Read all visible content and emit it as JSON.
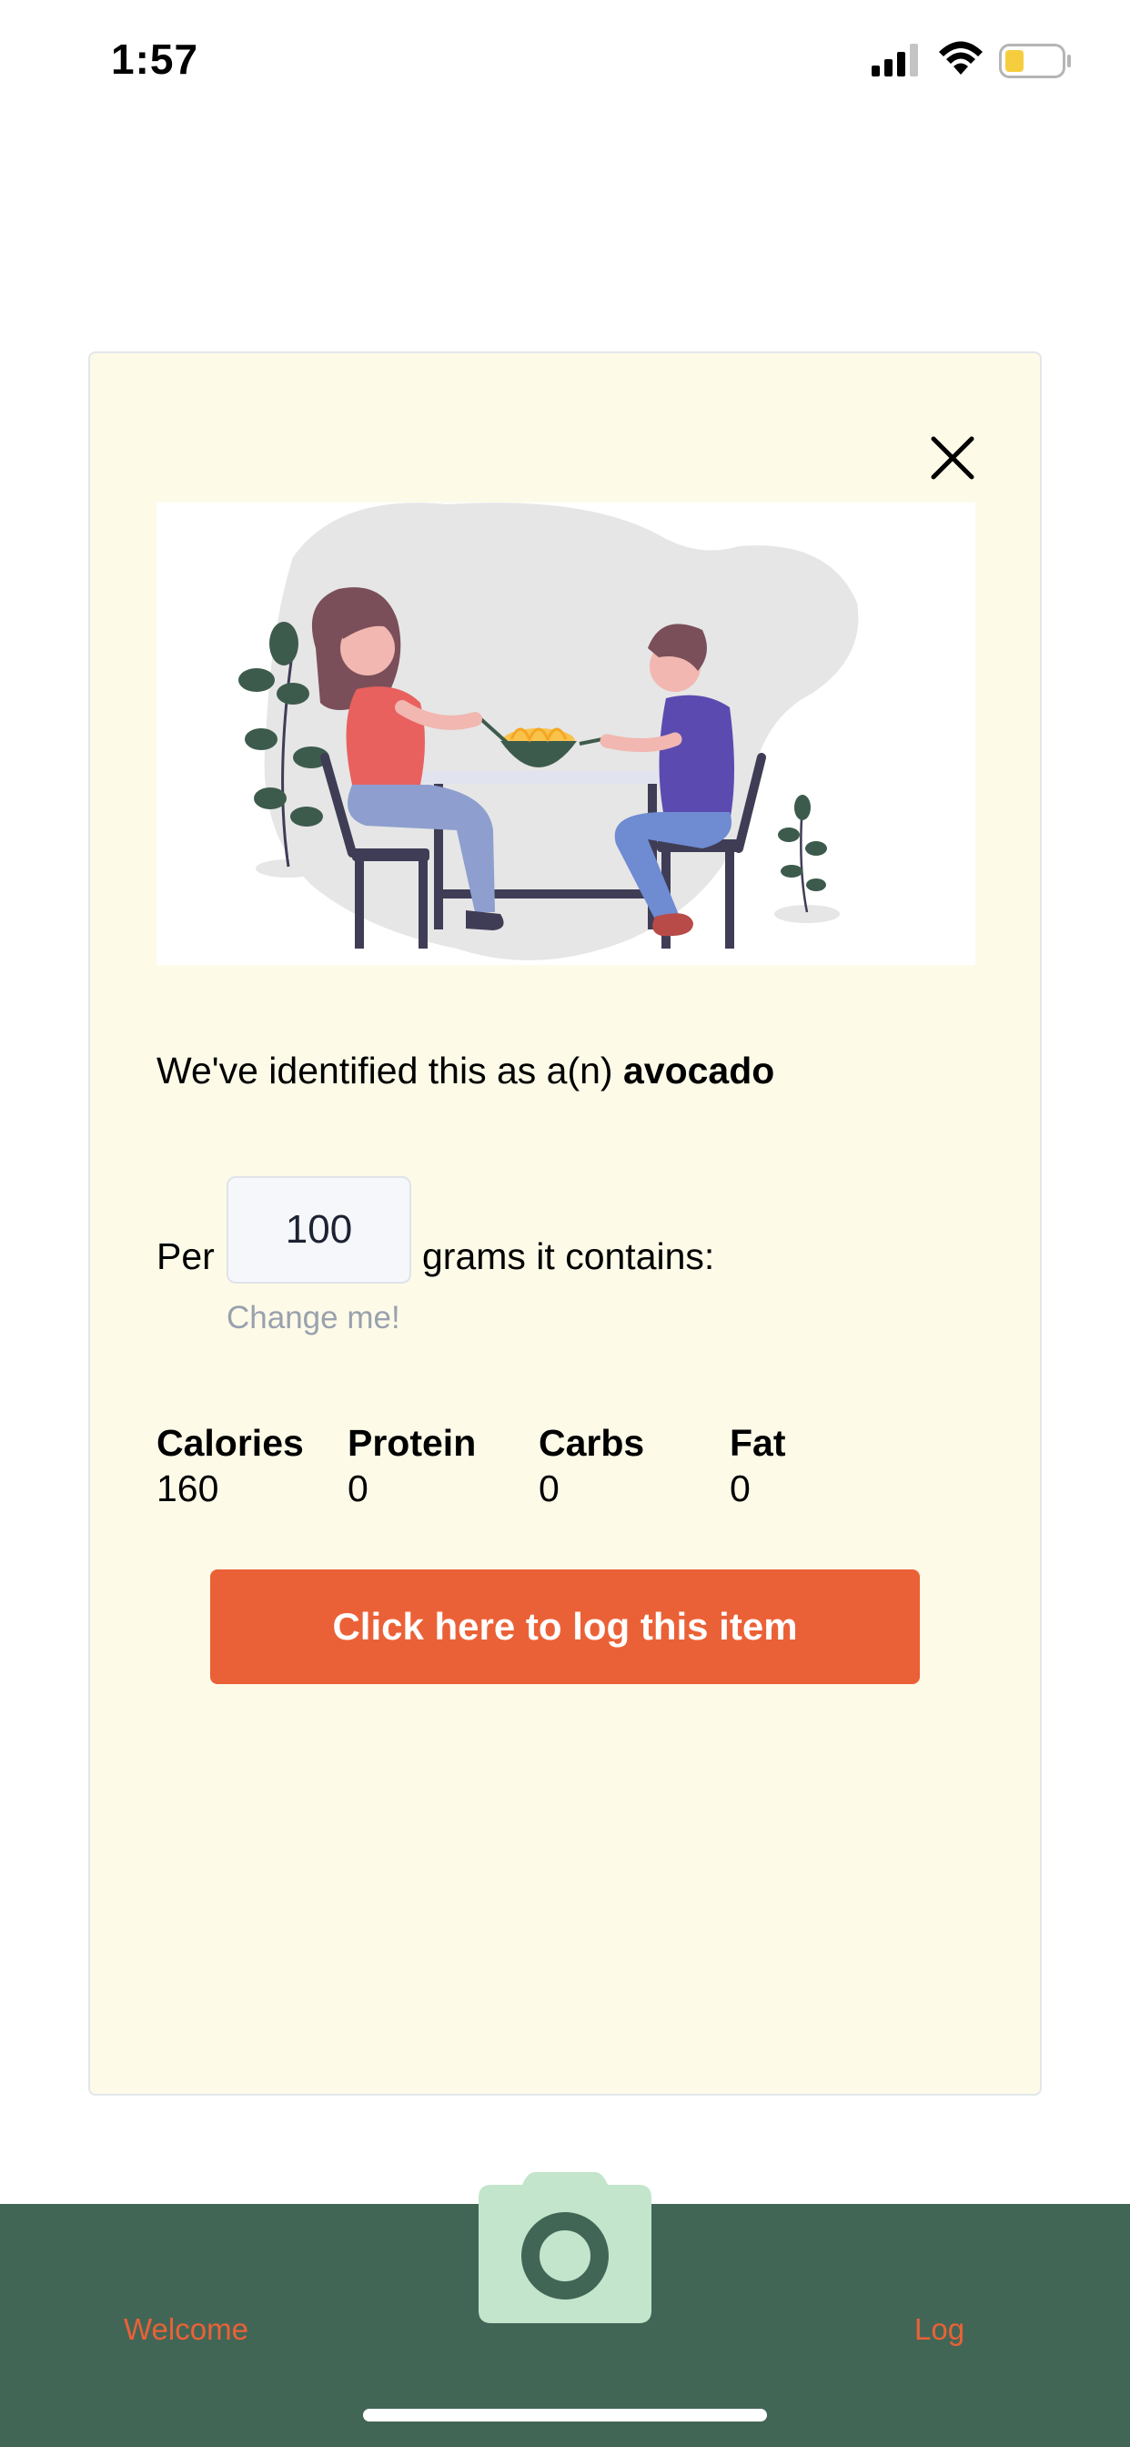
{
  "status_bar": {
    "time": "1:57"
  },
  "modal": {
    "identified_prefix": "We've identified this as a(n) ",
    "identified_food": "avocado",
    "per_label": "Per",
    "grams_value": "100",
    "grams_label": "grams it contains:",
    "change_hint": "Change me!",
    "nutrients": [
      {
        "label": "Calories",
        "value": "160"
      },
      {
        "label": "Protein",
        "value": "0"
      },
      {
        "label": "Carbs",
        "value": "0"
      },
      {
        "label": "Fat",
        "value": "0"
      }
    ],
    "log_button_label": "Click here to log this item"
  },
  "bottom_nav": {
    "welcome_label": "Welcome",
    "log_label": "Log"
  },
  "colors": {
    "card_background": "#fdfbe8",
    "accent": "#eb6137",
    "nav_background": "#426656",
    "camera_button": "#c2e5cb"
  },
  "icons": {
    "close": "close-icon",
    "camera": "camera-icon",
    "signal": "cellular-signal-icon",
    "wifi": "wifi-icon",
    "battery": "battery-icon"
  }
}
